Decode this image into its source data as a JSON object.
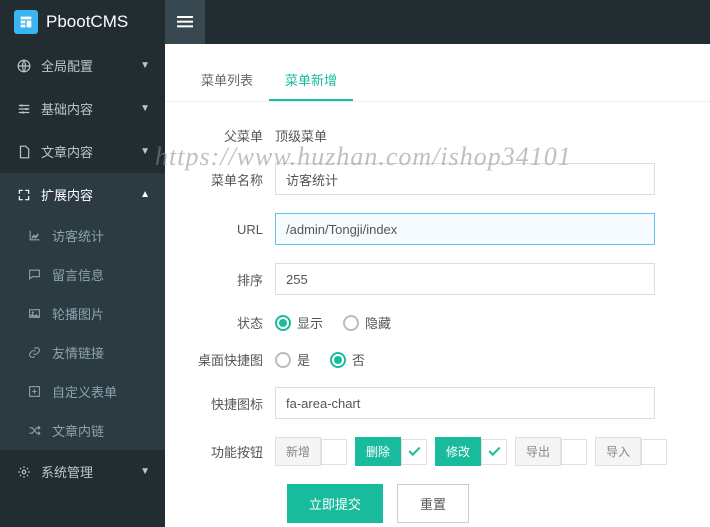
{
  "header": {
    "brand": "PbootCMS"
  },
  "sidebar": {
    "items": [
      {
        "label": "全局配置",
        "key": "global"
      },
      {
        "label": "基础内容",
        "key": "basic"
      },
      {
        "label": "文章内容",
        "key": "article"
      },
      {
        "label": "扩展内容",
        "key": "extend"
      },
      {
        "label": "系统管理",
        "key": "system"
      }
    ],
    "sub": [
      {
        "label": "访客统计"
      },
      {
        "label": "留言信息"
      },
      {
        "label": "轮播图片"
      },
      {
        "label": "友情链接"
      },
      {
        "label": "自定义表单"
      },
      {
        "label": "文章内链"
      }
    ]
  },
  "tabs": {
    "list": "菜单列表",
    "add": "菜单新增"
  },
  "form": {
    "parent_label": "父菜单",
    "parent_value": "顶级菜单",
    "name_label": "菜单名称",
    "name_value": "访客统计",
    "url_label": "URL",
    "url_value": "/admin/Tongji/index",
    "sort_label": "排序",
    "sort_value": "255",
    "status_label": "状态",
    "status_opts": {
      "show": "显示",
      "hide": "隐藏"
    },
    "shortcut_label": "桌面快捷图",
    "shortcut_opts": {
      "yes": "是",
      "no": "否"
    },
    "icon_label": "快捷图标",
    "icon_value": "fa-area-chart",
    "func_label": "功能按钮",
    "func": {
      "add": "新增",
      "del": "删除",
      "mod": "修改",
      "exp": "导出",
      "imp": "导入"
    },
    "submit": "立即提交",
    "reset": "重置"
  },
  "watermark": "https://www.huzhan.com/ishop34101"
}
